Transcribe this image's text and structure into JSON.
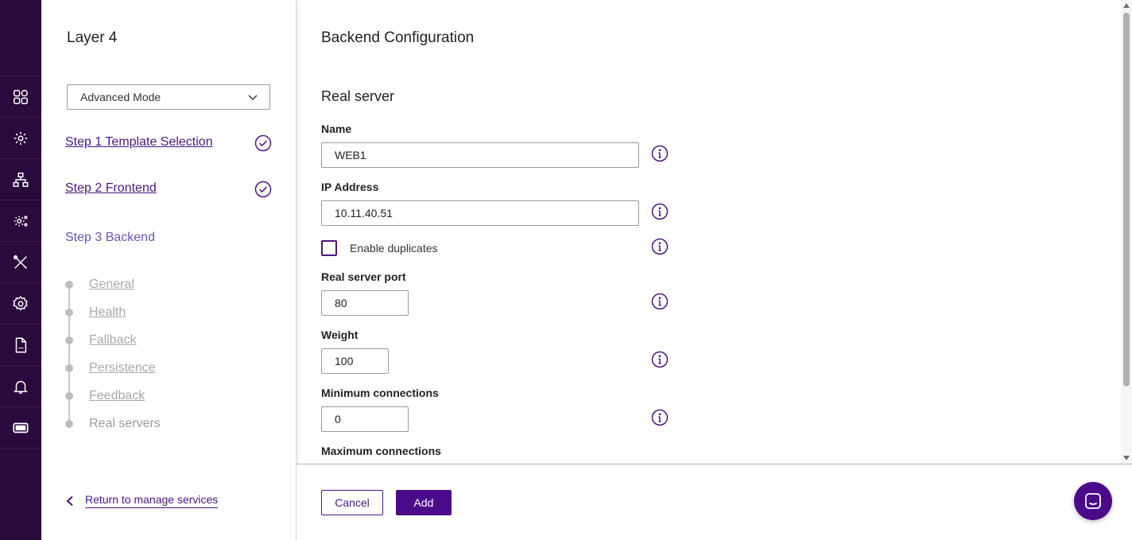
{
  "rail": {
    "icons": [
      "dashboard-icon",
      "services-gear-icon",
      "network-icon",
      "system-gear-icon",
      "tools-icon",
      "settings-icon",
      "logs-icon",
      "notifications-icon",
      "license-icon"
    ]
  },
  "wizard": {
    "title": "Layer 4",
    "mode": "Advanced Mode",
    "steps": [
      {
        "label": "Step 1 Template Selection",
        "done": true
      },
      {
        "label": "Step 2 Frontend",
        "done": true
      },
      {
        "label": "Step 3 Backend",
        "done": false
      }
    ],
    "substeps": [
      "General",
      "Health",
      "Fallback",
      "Persistence",
      "Feedback",
      "Real servers"
    ],
    "return_label": "Return to manage services"
  },
  "main": {
    "title": "Backend Configuration",
    "section": "Real server",
    "name_label": "Name",
    "name_value": "WEB1",
    "ip_label": "IP Address",
    "ip_value": "10.11.40.51",
    "duplicates_label": "Enable duplicates",
    "duplicates_checked": false,
    "port_label": "Real server port",
    "port_value": "80",
    "weight_label": "Weight",
    "weight_value": "100",
    "min_label": "Minimum connections",
    "min_value": "0",
    "max_label": "Maximum connections"
  },
  "footer": {
    "cancel": "Cancel",
    "add": "Add"
  },
  "colors": {
    "rail_bg": "#2a0a3d",
    "accent": "#4b0a8a",
    "link": "#4b1680"
  }
}
